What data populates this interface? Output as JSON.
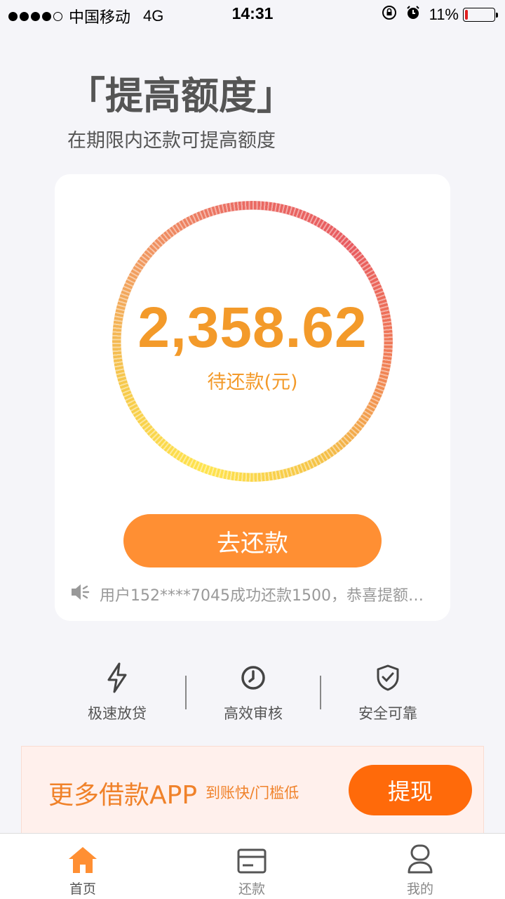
{
  "status_bar": {
    "carrier": "中国移动",
    "network": "4G",
    "time": "14:31",
    "battery": "11%",
    "battery_level": 0.11
  },
  "header": {
    "title": "「提高额度」",
    "subtitle": "在期限内还款可提高额度"
  },
  "card": {
    "amount": "2,358.62",
    "amount_label": "待还款(元)",
    "repay_button": "去还款",
    "notice": "用户152****7045成功还款1500，恭喜提额…"
  },
  "features": [
    {
      "label": "极速放贷",
      "icon": "lightning-icon"
    },
    {
      "label": "高效审核",
      "icon": "clock-icon"
    },
    {
      "label": "安全可靠",
      "icon": "shield-check-icon"
    }
  ],
  "promo": {
    "title": "更多借款APP",
    "subtitle": "到账快/门槛低",
    "button": "提现"
  },
  "tabs": [
    {
      "label": "首页",
      "icon": "home-icon",
      "active": true
    },
    {
      "label": "还款",
      "icon": "card-icon",
      "active": false
    },
    {
      "label": "我的",
      "icon": "user-icon",
      "active": false
    }
  ],
  "colors": {
    "accent": "#ff8f33",
    "amount": "#f39a2a",
    "withdraw": "#ff6a0a",
    "background": "#f5f5f9"
  }
}
